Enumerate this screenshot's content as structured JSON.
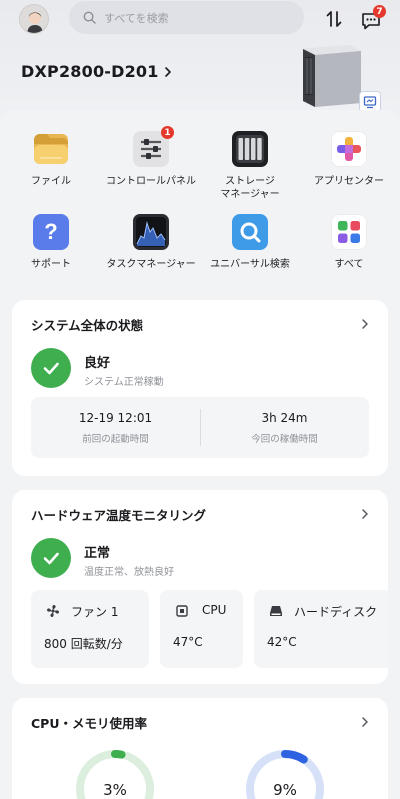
{
  "header": {
    "search_placeholder": "すべてを検索",
    "device_name": "DXP2800-D201",
    "message_count": "7"
  },
  "apps": [
    {
      "label": "ファイル",
      "icon": "folder-icon"
    },
    {
      "label": "コントロールパネル",
      "icon": "control-panel-icon",
      "badge": "1"
    },
    {
      "label": "ストレージ\nマネージャー",
      "icon": "storage-icon"
    },
    {
      "label": "アプリセンター",
      "icon": "app-center-icon"
    },
    {
      "label": "サポート",
      "icon": "support-icon"
    },
    {
      "label": "タスクマネージャー",
      "icon": "task-manager-icon"
    },
    {
      "label": "ユニバーサル検索",
      "icon": "universal-search-icon"
    },
    {
      "label": "すべて",
      "icon": "all-apps-icon"
    }
  ],
  "system": {
    "title": "システム全体の状態",
    "status": "良好",
    "status_sub": "システム正常稼動",
    "boot_time_value": "12-19 12:01",
    "boot_time_label": "前回の起動時間",
    "uptime_value": "3h 24m",
    "uptime_label": "今回の稼働時間"
  },
  "hardware": {
    "title": "ハードウェア温度モニタリング",
    "status": "正常",
    "status_sub": "温度正常、放熱良好",
    "tiles": [
      {
        "name": "ファン 1",
        "value": "800 回転数/分",
        "icon": "fan-icon"
      },
      {
        "name": "CPU",
        "value": "47°C",
        "icon": "cpu-icon"
      },
      {
        "name": "ハードディスク",
        "value": "42°C",
        "icon": "hard-disk-icon"
      }
    ]
  },
  "usage": {
    "title": "CPU・メモリ使用率",
    "cpu_percent": 3,
    "cpu_label": "3%",
    "memory_percent": 9,
    "memory_label": "9%",
    "colors": {
      "cpu": "#3fae4f",
      "cpu_track": "#dcefdf",
      "memory": "#2d62e0",
      "memory_track": "#d6e1f8"
    }
  }
}
